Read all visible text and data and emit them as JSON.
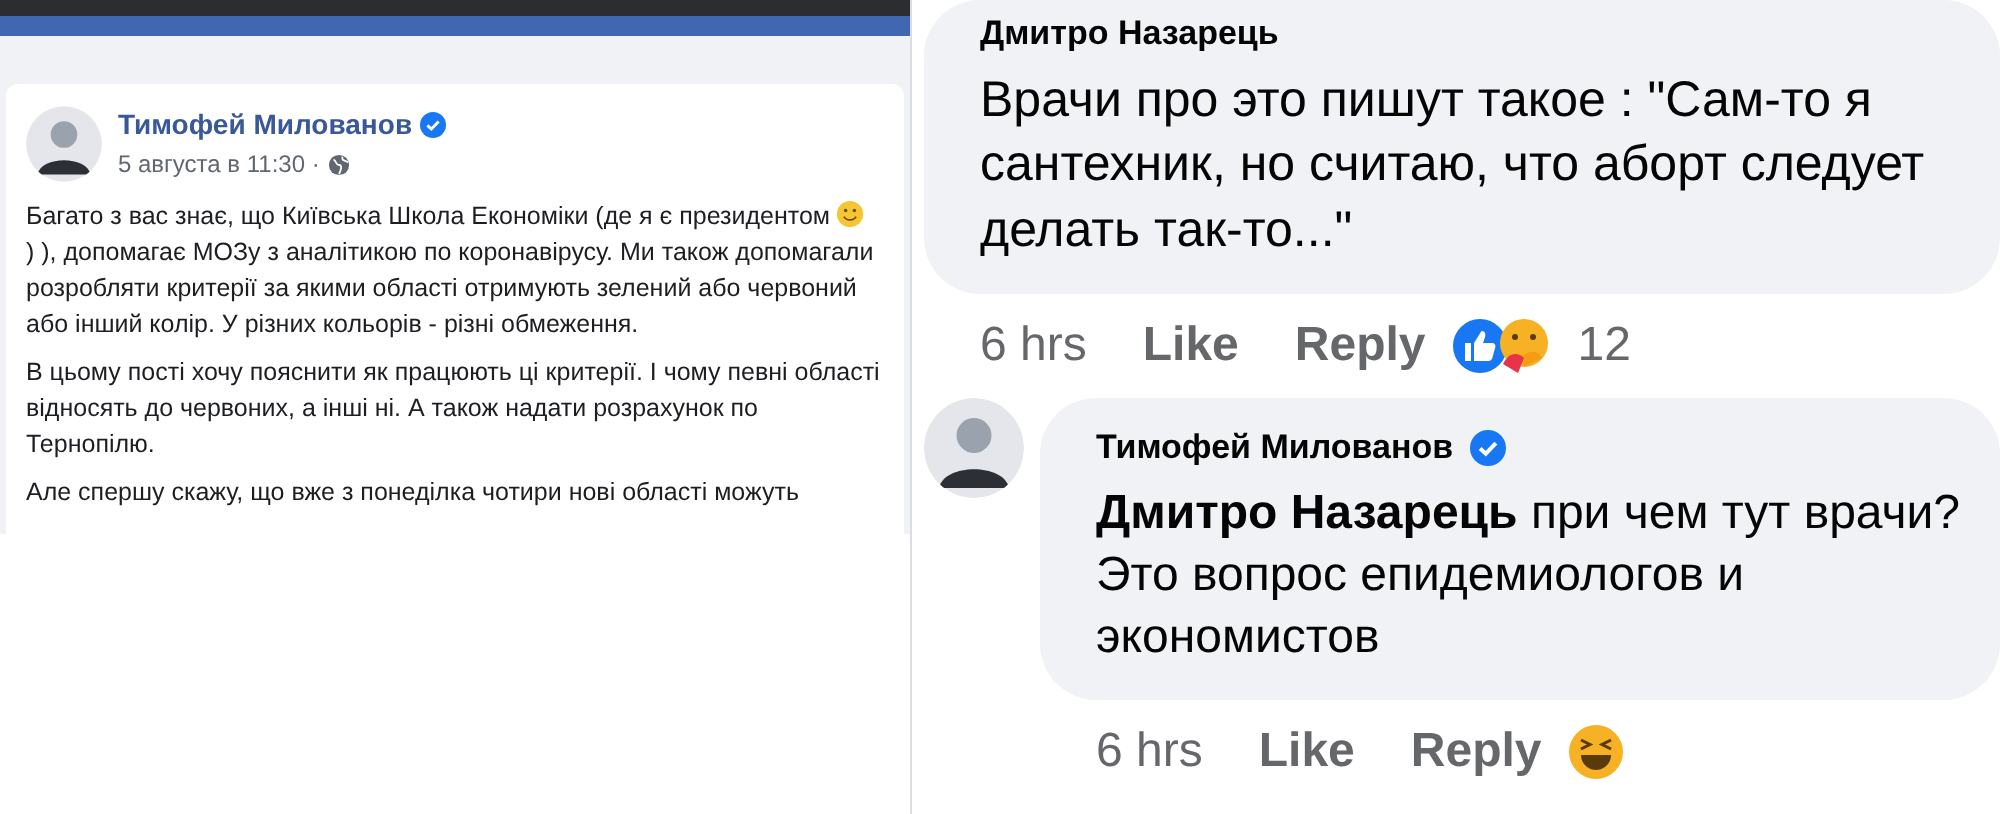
{
  "post": {
    "author": "Тимофей Милованов",
    "verified": true,
    "date": "5 августа в 11:30 ·",
    "paragraphs": [
      {
        "segments": [
          {
            "kind": "text",
            "text": "Багато з вас знає, що Київська Школа Економіки (де я є президентом"
          },
          {
            "kind": "emoji"
          },
          {
            "kind": "text",
            "text": ") ), допомагає МОЗу з аналітикою по коронавірусу. Ми також допомагали розробляти критерії за якими області отримують зелений або червоний або інший колір. У різних кольорів - різні обмеження."
          }
        ]
      },
      {
        "segments": [
          {
            "kind": "text",
            "text": "В цьому пості хочу пояснити як працюють ці критерії. І чому певні області відносять до червоних, а інші ні. А також надати розрахунок по Тернопілю."
          }
        ]
      },
      {
        "segments": [
          {
            "kind": "text",
            "text": "Але спершу скажу, що вже з понеділка чотири нові області можуть"
          }
        ]
      }
    ]
  },
  "comments": [
    {
      "author": "Дмитро Назарець",
      "verified": false,
      "avatar": false,
      "text": "Врачи про это пишут такое : \"Сам-то я сантехник, но считаю, что аборт следует делать так-то...\"",
      "time": "6 hrs",
      "like": "Like",
      "reply": "Reply",
      "reactions": [
        {
          "kind": "like"
        },
        {
          "kind": "care"
        }
      ],
      "reaction_count": "12"
    },
    {
      "author": "Тимофей Милованов",
      "verified": true,
      "avatar": true,
      "text": "**Дмитро Назарець** при чем тут врачи? Это вопрос епидемиологов и экономистов",
      "time": "6 hrs",
      "like": "Like",
      "reply": "Reply",
      "reactions": [
        {
          "kind": "haha"
        }
      ]
    }
  ]
}
